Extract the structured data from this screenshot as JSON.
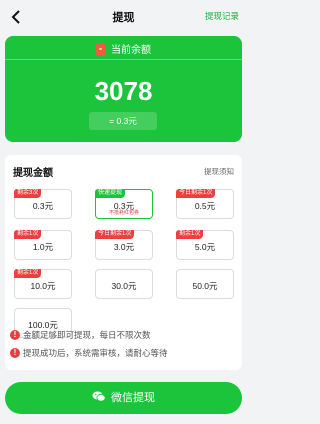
{
  "header": {
    "title": "提现",
    "records_link": "提现记录"
  },
  "balance": {
    "label": "当前余额",
    "amount": "3078",
    "rmb_equivalent": "= 0.3元"
  },
  "withdraw": {
    "section_title": "提现金额",
    "notice_link": "提现须知",
    "options": [
      {
        "value": "0.3元",
        "tag": "剩余3次",
        "tag_color": "red",
        "sub": "",
        "selected": false
      },
      {
        "value": "0.3元",
        "tag": "快速提现",
        "tag_color": "green",
        "sub": "不抵耗红包券",
        "selected": true
      },
      {
        "value": "0.5元",
        "tag": "今日剩余1次",
        "tag_color": "red",
        "sub": "",
        "selected": false
      },
      {
        "value": "1.0元",
        "tag": "剩余1次",
        "tag_color": "red",
        "sub": "",
        "selected": false
      },
      {
        "value": "3.0元",
        "tag": "今日剩余1次",
        "tag_color": "red",
        "sub": "",
        "selected": false
      },
      {
        "value": "5.0元",
        "tag": "剩余1次",
        "tag_color": "red",
        "sub": "",
        "selected": false
      },
      {
        "value": "10.0元",
        "tag": "剩余1次",
        "tag_color": "red",
        "sub": "",
        "selected": false
      },
      {
        "value": "30.0元",
        "tag": "",
        "tag_color": "",
        "sub": "",
        "selected": false
      },
      {
        "value": "50.0元",
        "tag": "",
        "tag_color": "",
        "sub": "",
        "selected": false
      },
      {
        "value": "100.0元",
        "tag": "",
        "tag_color": "",
        "sub": "",
        "selected": false
      }
    ]
  },
  "tips": [
    "金额足够即可提现，每日不限次数",
    "提现成功后，系统需审核，请耐心等待"
  ],
  "action": {
    "button_label": "微信提现"
  },
  "colors": {
    "brand_green": "#1cc43b",
    "tag_red": "#ec4040",
    "background": "#f2f3f5"
  }
}
